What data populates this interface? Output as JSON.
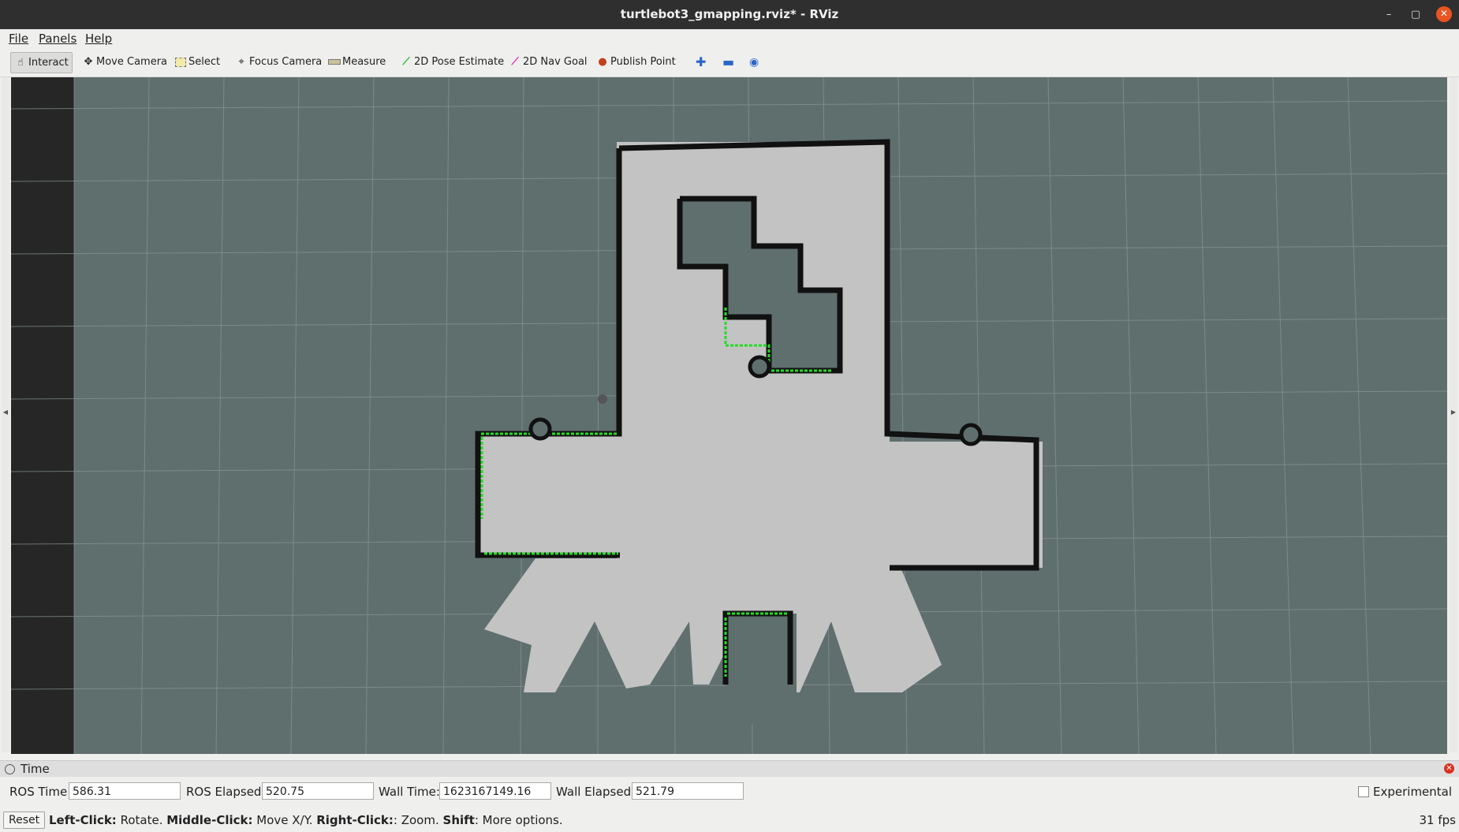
{
  "window": {
    "title": "turtlebot3_gmapping.rviz* - RViz",
    "minimize": "–",
    "maximize": "▢",
    "close": "✕"
  },
  "menu": {
    "file": "File",
    "panels": "Panels",
    "help": "Help"
  },
  "toolbar": {
    "interact": "Interact",
    "move_camera": "Move Camera",
    "select": "Select",
    "focus_camera": "Focus Camera",
    "measure": "Measure",
    "pose_estimate": "2D Pose Estimate",
    "nav_goal": "2D Nav Goal",
    "publish_point": "Publish Point"
  },
  "time_panel": {
    "title": "Time",
    "ros_time_label": "ROS Time:",
    "ros_time": "586.31",
    "ros_elapsed_label": "ROS Elapsed:",
    "ros_elapsed": "520.75",
    "wall_time_label": "Wall Time:",
    "wall_time": "1623167149.16",
    "wall_elapsed_label": "Wall Elapsed:",
    "wall_elapsed": "521.79",
    "experimental_label": "Experimental"
  },
  "status": {
    "reset": "Reset",
    "left_click": "Left-Click:",
    "left_click_desc": " Rotate. ",
    "middle_click": "Middle-Click:",
    "middle_click_desc": " Move X/Y. ",
    "right_click": "Right-Click:",
    "right_click_desc": ": Zoom. ",
    "shift": "Shift",
    "shift_desc": ": More options.",
    "fps": "31 fps"
  },
  "colors": {
    "viewport_bg": "#5f6f6e",
    "free_space": "#c3c3c3",
    "obstacle": "#111111",
    "laser_scan": "#22dd22",
    "grid": "#8a9695"
  },
  "icons": {
    "interact": "hand-icon",
    "move_camera": "move-icon",
    "select": "select-icon",
    "focus_camera": "focus-icon",
    "measure": "ruler-icon",
    "pose_estimate": "arrow-icon",
    "nav_goal": "arrow-icon",
    "publish_point": "pin-icon"
  }
}
